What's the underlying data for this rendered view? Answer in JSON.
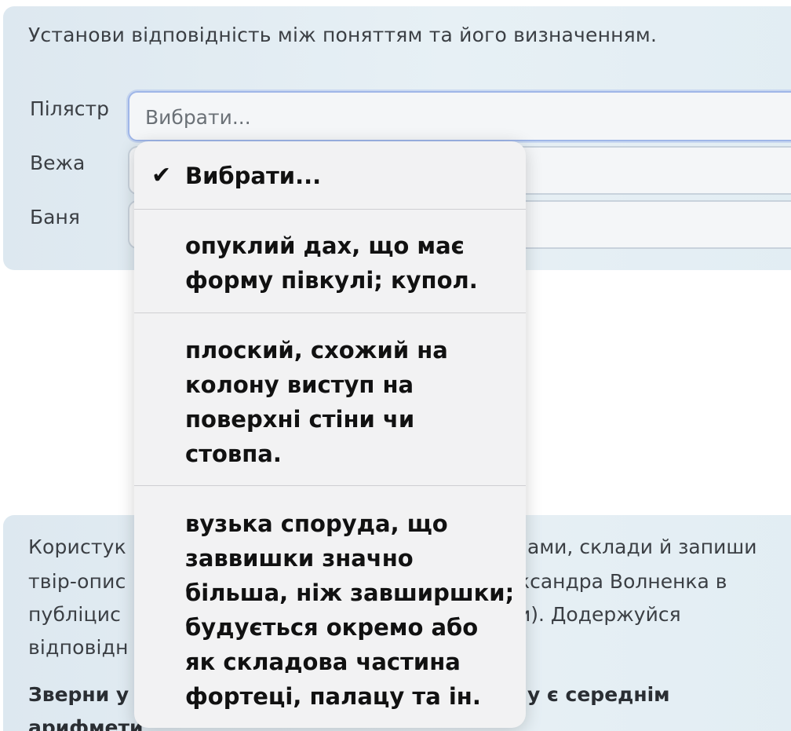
{
  "task": {
    "prompt": "Установи відповідність між поняттям та його визначенням.",
    "rows": [
      {
        "label": "Пілястр",
        "selected": "Вибрати..."
      },
      {
        "label": "Вежа",
        "selected": ""
      },
      {
        "label": "Баня",
        "selected": ""
      }
    ]
  },
  "dropdown": {
    "options": [
      {
        "label": "Вибрати...",
        "checked": true
      },
      {
        "label": "опуклий дах, що має\nформу півкулі; купол.",
        "checked": false
      },
      {
        "label": "плоский, схожий на\nколону виступ на\nповерхні стіни чи\nстовпа.",
        "checked": false
      },
      {
        "label": "вузька споруда, що\nзаввишки значно\nбільша, ніж завширшки;\nбудується окремо або\nяк складова частина\nфортеці, палацу та ін.",
        "checked": false
      }
    ],
    "check_glyph": "✔"
  },
  "next_task": {
    "line1_left": "Користук",
    "line1_right": "ами, склади й запиши",
    "line2_left": "твір-опис",
    "line2_right": "ксандра Волненка в",
    "line3_left": "публіцис",
    "line3_right": "и). Додержуйся",
    "line4_left": "відповідн",
    "bold1_left": "Зверни у",
    "bold1_right": "у є середнім",
    "bold2_left": "арифмети"
  }
}
